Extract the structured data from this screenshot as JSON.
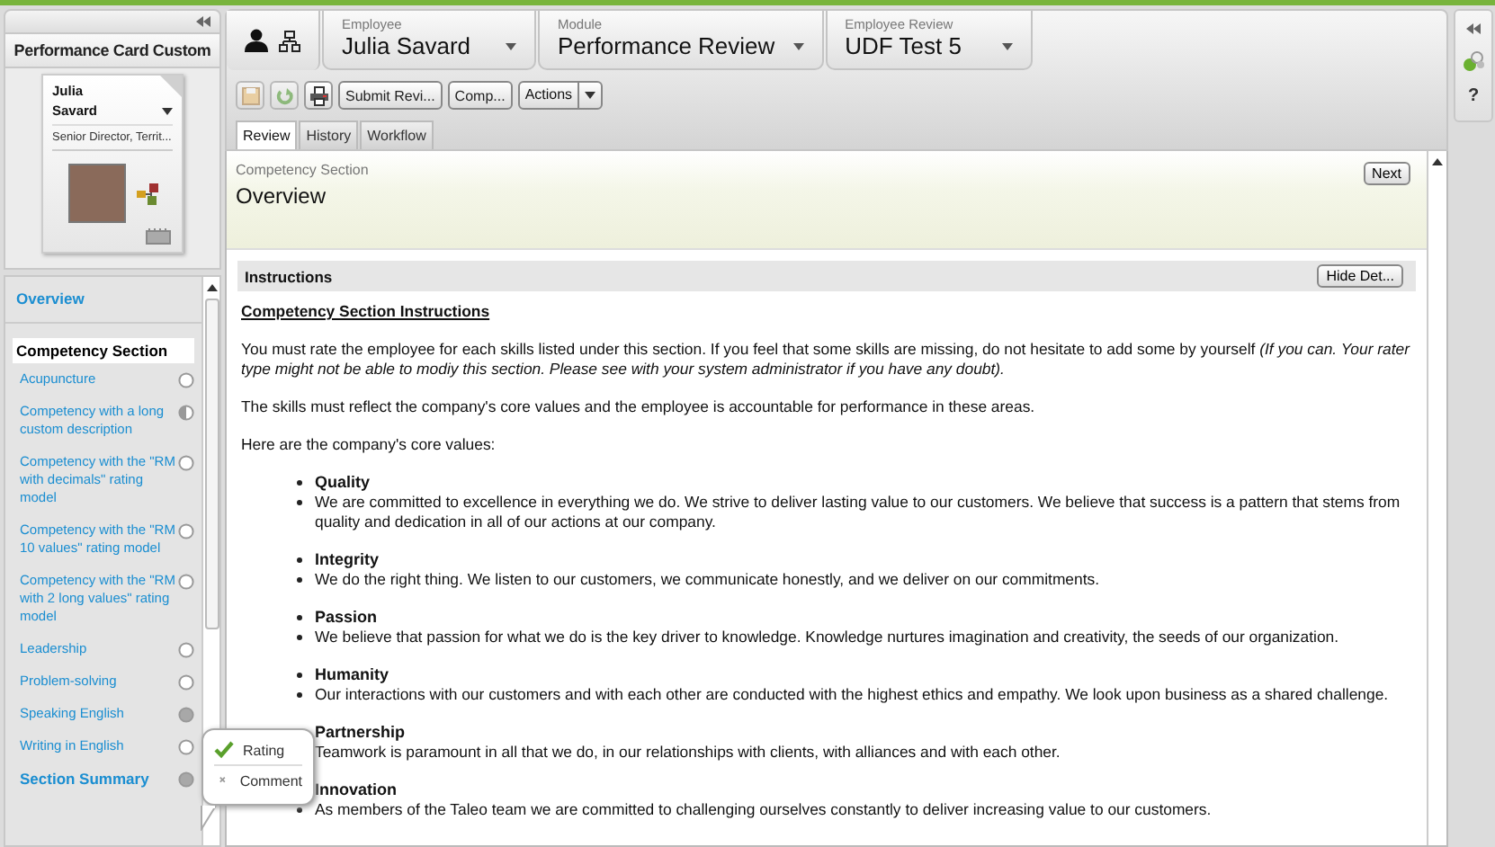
{
  "sidebar": {
    "title": "Performance Card Custom",
    "card": {
      "first_name": "Julia",
      "last_name": "Savard",
      "job_title": "Senior Director, Territ..."
    },
    "overview": {
      "label": "Overview",
      "selected": false
    },
    "section": {
      "label": "Competency Section",
      "selected": true
    },
    "items": [
      {
        "label": "Acupuncture",
        "rated": false,
        "commented": false
      },
      {
        "label": "Competency with a long custom description",
        "rated": true,
        "commented": false
      },
      {
        "label": "Competency with the \"RM with decimals\" rating model",
        "rated": false,
        "commented": false
      },
      {
        "label": "Competency with the \"RM 10 values\" rating model",
        "rated": false,
        "commented": false
      },
      {
        "label": "Competency with the \"RM with 2 long values\" rating model",
        "rated": false,
        "commented": false
      },
      {
        "label": "Leadership",
        "rated": false,
        "commented": false
      },
      {
        "label": "Problem-solving",
        "rated": false,
        "commented": false
      },
      {
        "label": "Speaking English",
        "rated": true,
        "commented": true
      },
      {
        "label": "Writing in English",
        "rated": false,
        "commented": false
      }
    ],
    "summary": {
      "label": "Section Summary",
      "rated": true,
      "commented": true
    },
    "popup": [
      {
        "label": "Rating",
        "done": true
      },
      {
        "label": "Comment",
        "done": false
      }
    ]
  },
  "header": {
    "selectors": [
      {
        "label": "Employee",
        "value": "Julia Savard"
      },
      {
        "label": "Module",
        "value": "Performance Review"
      },
      {
        "label": "Employee Review",
        "value": "UDF Test 5"
      }
    ]
  },
  "toolbar": {
    "icon_buttons": [
      {
        "kind": "save",
        "disabled": true
      },
      {
        "kind": "refresh",
        "disabled": true
      },
      {
        "kind": "print",
        "disabled": false
      }
    ],
    "buttons": [
      "Submit Revi...",
      "Comp..."
    ],
    "menu_button": "Actions"
  },
  "tabs": [
    {
      "label": "Review",
      "selected": true
    },
    {
      "label": "History",
      "selected": false
    },
    {
      "label": "Workflow",
      "selected": false
    }
  ],
  "section": {
    "subtitle": "Competency Section",
    "title": "Overview",
    "next": "Next"
  },
  "instructions": {
    "title": "Instructions",
    "toggle": "Hide Det...",
    "heading": "Competency Section Instructions",
    "paragraphs": [
      "You must rate the employee for each skills listed under this section. If you feel that some skills are missing, do not hesitate to add some by yourself *(If you can. Your rater type might not be able to modiy this section. Please see with your system administrator if you have any doubt).*",
      "The skills must reflect the company's core values and the employee is accountable for performance in these areas.",
      "Here are the company's core values:"
    ],
    "values": [
      {
        "name": "Quality",
        "description": "We are committed to excellence in everything we do. We strive to deliver lasting value to our customers. We believe that success is a pattern that stems from quality and dedication in all of our actions at our company."
      },
      {
        "name": "Integrity",
        "description": "We do the right thing. We listen to our customers, we communicate honestly, and we deliver on our commitments."
      },
      {
        "name": "Passion",
        "description": "We believe that passion for what we do is the key driver to knowledge. Knowledge nurtures imagination and creativity, the seeds of our organization."
      },
      {
        "name": "Humanity",
        "description": "Our interactions with our customers and with each other are conducted with the highest ethics and empathy. We look upon business as a shared challenge."
      },
      {
        "name": "Partnership",
        "description": "Teamwork is paramount in all that we do, in our relationships with clients, with alliances and with each other."
      },
      {
        "name": "Innovation",
        "description": "As members of the Taleo team we are committed to challenging ourselves constantly to deliver increasing value to our customers."
      }
    ]
  },
  "rail": {
    "help": "?"
  }
}
